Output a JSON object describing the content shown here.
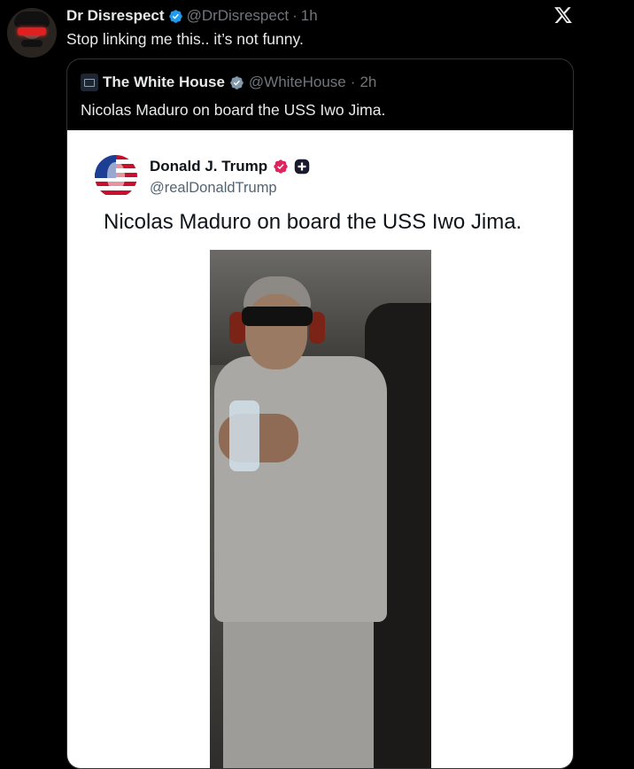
{
  "post": {
    "author_name": "Dr Disrespect",
    "author_handle": "@DrDisrespect",
    "separator": "·",
    "time": "1h",
    "text": "Stop linking me this.. it’s not funny."
  },
  "quoted": {
    "author_name": "The White House",
    "author_handle": "@WhiteHouse",
    "separator": "·",
    "time": "2h",
    "text": "Nicolas Maduro on board the USS Iwo Jima."
  },
  "embedded": {
    "author_name": "Donald J. Trump",
    "author_handle": "@realDonaldTrump",
    "text": "Nicolas Maduro on board the USS Iwo Jima."
  },
  "icons": {
    "verified": "verified-badge-icon",
    "brand": "x-logo-icon",
    "platform_badge": "truth-social-badge-icon"
  },
  "colors": {
    "background": "#000000",
    "verified_blue": "#1d9bf0",
    "verified_red": "#e0245e",
    "muted_text": "#71767b"
  }
}
